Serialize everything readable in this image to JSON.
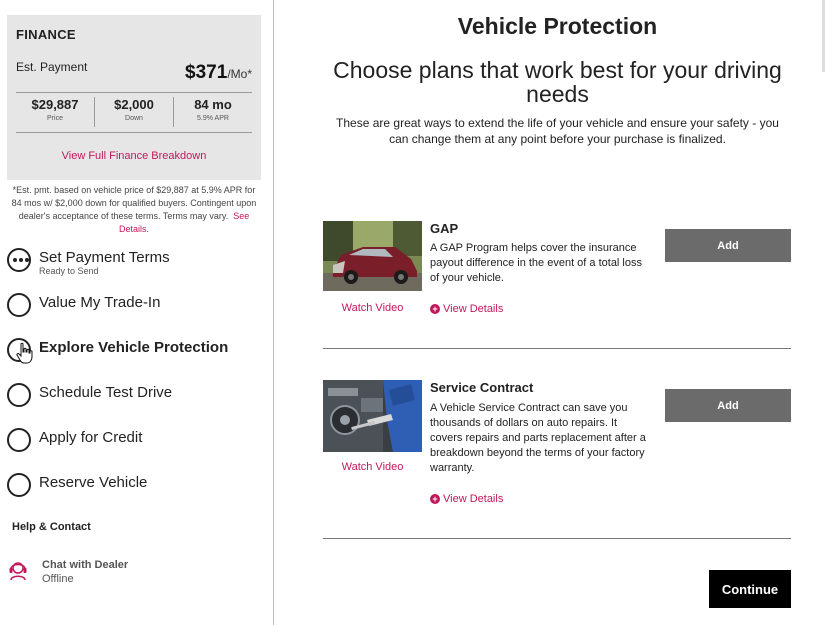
{
  "finance": {
    "title": "FINANCE",
    "est_label": "Est. Payment",
    "est_amount": "$371",
    "est_period": "/Mo*",
    "stats": [
      {
        "value": "$29,887",
        "label": "Price"
      },
      {
        "value": "$2,000",
        "label": "Down"
      },
      {
        "value": "84 mo",
        "label": "5.9% APR"
      }
    ],
    "breakdown_link": "View Full Finance Breakdown",
    "disclaimer": "*Est. pmt. based on vehicle price of $29,887 at 5.9% APR for 84 mos w/ $2,000 down for qualified buyers. Contingent upon dealer's acceptance of these terms. Terms may vary.",
    "see_details": "See Details."
  },
  "steps": [
    {
      "label": "Set Payment Terms",
      "sublabel": "Ready to Send",
      "state": "in-progress"
    },
    {
      "label": "Value My Trade-In",
      "sublabel": "",
      "state": "todo"
    },
    {
      "label": "Explore Vehicle Protection",
      "sublabel": "",
      "state": "active"
    },
    {
      "label": "Schedule Test Drive",
      "sublabel": "",
      "state": "todo"
    },
    {
      "label": "Apply for Credit",
      "sublabel": "",
      "state": "todo"
    },
    {
      "label": "Reserve Vehicle",
      "sublabel": "",
      "state": "todo"
    }
  ],
  "help": {
    "title": "Help & Contact",
    "chat_label": "Chat with Dealer",
    "chat_status": "Offline",
    "chat_icon": "headset-icon"
  },
  "main": {
    "title": "Vehicle Protection",
    "subtitle": "Choose plans that work best for your driving needs",
    "description": "These are great ways to extend the life of your vehicle and ensure your safety - you can change them at any point before your purchase is finalized.",
    "plans": [
      {
        "title": "GAP",
        "description": "A GAP Program helps cover the insurance payout difference in the event of a total loss of your vehicle.",
        "watch_video": "Watch Video",
        "view_details": "View Details",
        "add_label": "Add"
      },
      {
        "title": "Service Contract",
        "description": "A Vehicle Service Contract can save you thousands of dollars on auto repairs. It covers repairs and parts replacement after a breakdown beyond the terms of your factory warranty.",
        "watch_video": "Watch Video",
        "view_details": "View Details",
        "add_label": "Add"
      }
    ],
    "continue_label": "Continue"
  },
  "colors": {
    "accent": "#c2185b",
    "button_gray": "#6b6b6b",
    "finance_bg": "#e6e6e6"
  }
}
